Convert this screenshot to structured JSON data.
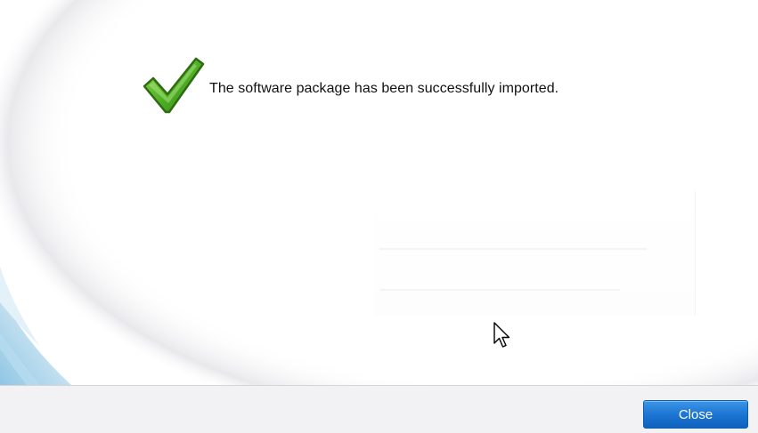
{
  "dialog": {
    "message": "The software package has been successfully imported."
  },
  "footer": {
    "close_label": "Close"
  },
  "icons": {
    "status": "check-mark-icon",
    "cursor": "mouse-pointer-icon"
  },
  "colors": {
    "check_green": "#5cb82e",
    "check_outline": "#2e6b12",
    "button_blue": "#1c76d3",
    "footer_bg": "#f2f2f4"
  }
}
